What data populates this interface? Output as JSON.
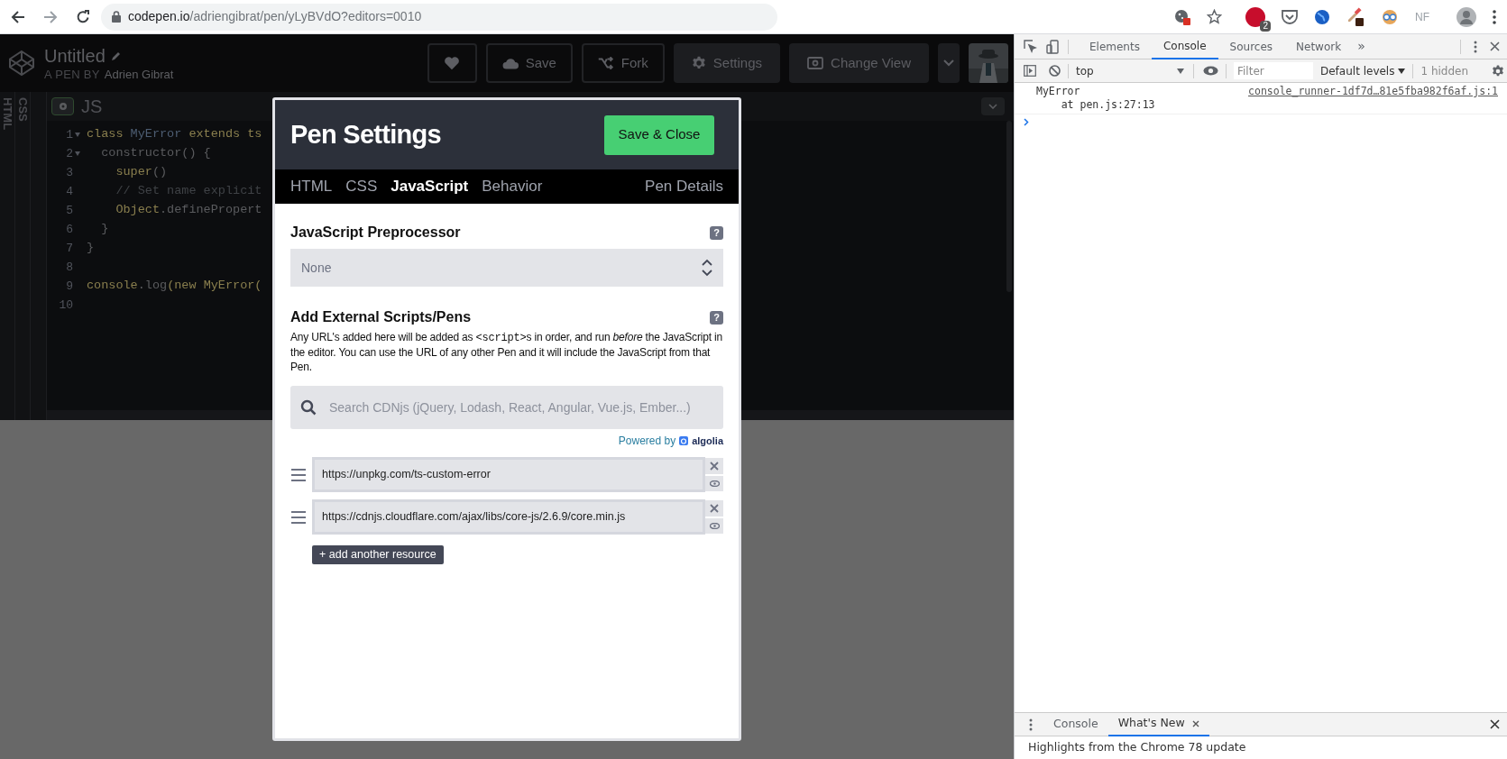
{
  "browser": {
    "url_domain": "codepen.io",
    "url_path": "/adriengibrat/pen/yLyBVdO?editors=0010",
    "adblock_count": "2",
    "profile_initials": "NF"
  },
  "header": {
    "title": "Untitled",
    "byline_prefix": "A PEN BY",
    "author": "Adrien Gibrat",
    "buttons": [
      {
        "kind": "heart"
      },
      {
        "kind": "save",
        "label": "Save"
      },
      {
        "kind": "fork",
        "label": "Fork"
      },
      {
        "kind": "settings",
        "label": "Settings"
      },
      {
        "kind": "view",
        "label": "Change View"
      },
      {
        "kind": "caret"
      }
    ]
  },
  "editor": {
    "side_tabs": [
      "HTML",
      "CSS"
    ],
    "title": "JS",
    "lines": [
      {
        "number": "1",
        "fold": true,
        "segments": [
          {
            "kind": "keyword",
            "text": "class "
          },
          {
            "kind": "def",
            "text": "MyError "
          },
          {
            "kind": "keyword",
            "text": "extends ts"
          }
        ]
      },
      {
        "number": "2",
        "fold": true,
        "segments": [
          {
            "kind": "plain",
            "text": "  constructor() {"
          }
        ]
      },
      {
        "number": "3",
        "fold": false,
        "segments": [
          {
            "kind": "keyword",
            "text": "    super"
          },
          {
            "kind": "plain",
            "text": "()"
          }
        ]
      },
      {
        "number": "4",
        "fold": false,
        "segments": [
          {
            "kind": "comment",
            "text": "    // Set name explicit"
          }
        ]
      },
      {
        "number": "5",
        "fold": false,
        "segments": [
          {
            "kind": "keyword",
            "text": "    Object"
          },
          {
            "kind": "plain",
            "text": ".definePropert"
          }
        ]
      },
      {
        "number": "6",
        "fold": false,
        "segments": [
          {
            "kind": "plain",
            "text": "  }"
          }
        ]
      },
      {
        "number": "7",
        "fold": false,
        "segments": [
          {
            "kind": "plain",
            "text": "}"
          }
        ]
      },
      {
        "number": "8",
        "fold": false
      },
      {
        "number": "9",
        "fold": false,
        "segments": [
          {
            "kind": "keyword",
            "text": "console"
          },
          {
            "kind": "plain",
            "text": ".log"
          },
          {
            "kind": "keyword",
            "text": "(new MyError("
          }
        ]
      },
      {
        "number": "10",
        "fold": false
      }
    ]
  },
  "modal": {
    "title": "Pen Settings",
    "save_button": "Save & Close",
    "tabs": [
      {
        "label": "HTML",
        "selected": false
      },
      {
        "label": "CSS",
        "selected": false
      },
      {
        "label": "JavaScript",
        "selected": true
      },
      {
        "label": "Behavior",
        "selected": false
      }
    ],
    "details_tab": "Pen Details",
    "preprocessor": {
      "heading": "JavaScript Preprocessor",
      "help": "?",
      "value": "None"
    },
    "external": {
      "heading": "Add External Scripts/Pens",
      "help": "?",
      "description": [
        {
          "kind": "text",
          "text": "Any URL's added here will be added as "
        },
        {
          "kind": "code",
          "text": "<script>"
        },
        {
          "kind": "text",
          "text": "s in order, and run *before* the JavaScript in the editor. You can use the URL of any other Pen and it will include the JavaScript from that Pen."
        }
      ],
      "search_placeholder": "Search CDNjs (jQuery, Lodash, React, Angular, Vue.js, Ember...)",
      "powered_by": "Powered by",
      "powered_brand": "algolia",
      "resources": [
        {
          "url": "https://unpkg.com/ts-custom-error"
        },
        {
          "url": "https://cdnjs.cloudflare.com/ajax/libs/core-js/2.6.9/core.min.js"
        }
      ],
      "add_button": "+ add another resource"
    }
  },
  "devtools": {
    "tabs": [
      {
        "label": "Elements",
        "selected": false
      },
      {
        "label": "Console",
        "selected": true
      },
      {
        "label": "Sources",
        "selected": false
      },
      {
        "label": "Network",
        "selected": false
      }
    ],
    "more_tabs": "»",
    "context": "top",
    "filter_placeholder": "Filter",
    "levels": "Default levels",
    "hidden": "1 hidden",
    "messages": [
      {
        "text": "MyError",
        "detail": "    at pen.js:27:13",
        "source": "console_runner-1df7d…81e5fba982f6af.js:1"
      }
    ],
    "drawer": {
      "tabs": [
        {
          "label": "Console",
          "selected": false,
          "closable": false
        },
        {
          "label": "What's New",
          "selected": true,
          "closable": true
        }
      ],
      "content": "Highlights from the Chrome 78 update"
    }
  }
}
